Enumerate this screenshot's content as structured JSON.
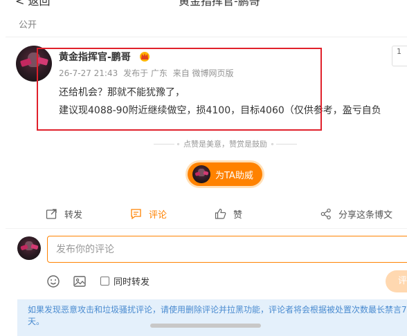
{
  "header": {
    "back_label": "< 返回",
    "title": "黄金指挥官-鹏哥"
  },
  "post": {
    "visibility": "公开",
    "author": {
      "name": "黄金指挥官-鹏哥"
    },
    "meta": {
      "time": "26-7-27 21:43",
      "published_in": "发布于 广东",
      "source": "来自 微博网页版"
    },
    "content_lines": [
      "还给机会？那就不能犹豫了，",
      "建议现4088-90附近继续做空，损4100，目标4060（仅供参考，盈亏自负"
    ],
    "follow_stub": "1"
  },
  "like_tip": "点赞是美意，赞赏是鼓励",
  "support_button": "为TA助威",
  "actions": {
    "repost": "转发",
    "comment": "评论",
    "like": "赞",
    "share": "分享这条博文"
  },
  "comment": {
    "placeholder": "发布你的评论",
    "repost_label": "同时转发",
    "submit_label": "评"
  },
  "notice": "如果发现恶意攻击和垃圾骚扰评论，请使用删除评论并拉黑功能，评论者将会根据被处置次数最长禁言7天。",
  "colors": {
    "accent": "#ff8200",
    "highlight_box": "#e0202a",
    "notice_bg": "#e4f0fb",
    "notice_text": "#4a8bd0"
  }
}
